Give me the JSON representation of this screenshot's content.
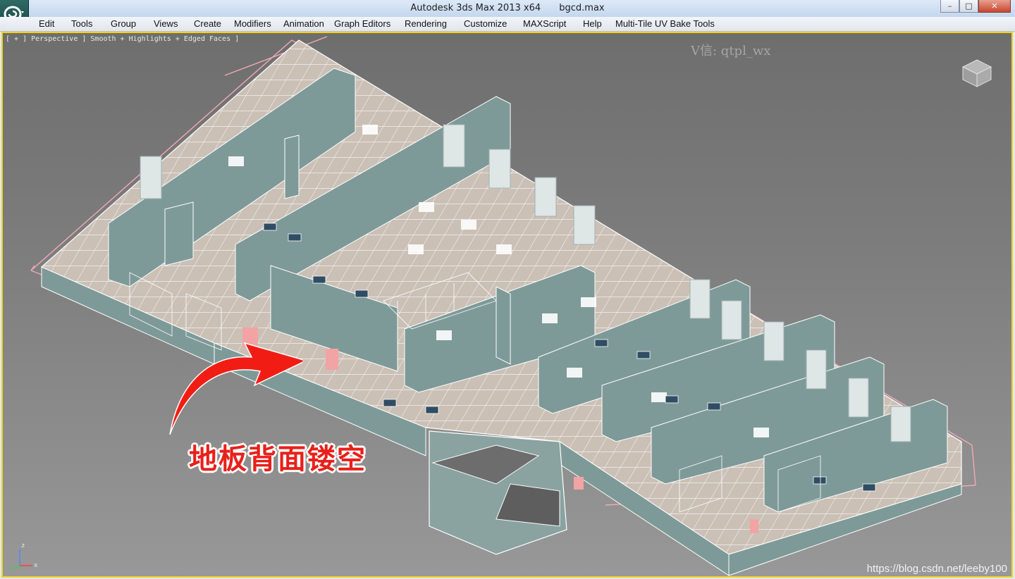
{
  "window": {
    "app_name": "Autodesk 3ds Max  2013 x64",
    "file_name": "bgcd.max",
    "buttons": {
      "minimize": "–",
      "maximize": "□",
      "close": "✕"
    }
  },
  "menu": {
    "items": [
      "Edit",
      "Tools",
      "Group",
      "Views",
      "Create",
      "Modifiers",
      "Animation",
      "Graph Editors",
      "Rendering",
      "Customize",
      "MAXScript",
      "Help",
      "Multi-Tile UV Bake Tools"
    ]
  },
  "viewport": {
    "label": "[ + ] Perspective ] Smooth + Highlights + Edged Faces ]",
    "watermark": "V信: qtpl_wx",
    "annotation": "地板背面镂空",
    "credit": "https://blog.csdn.net/leeby100",
    "axis": {
      "z": "z",
      "x": "x"
    }
  },
  "colors": {
    "selection_border": "#f4d21a",
    "annotation": "#e8201a",
    "wall": "#7e9a98",
    "floor": "#c9beb4"
  },
  "icons": [
    "max-logo-icon",
    "viewcube-icon",
    "red-arrow-icon",
    "axis-gizmo-icon"
  ]
}
